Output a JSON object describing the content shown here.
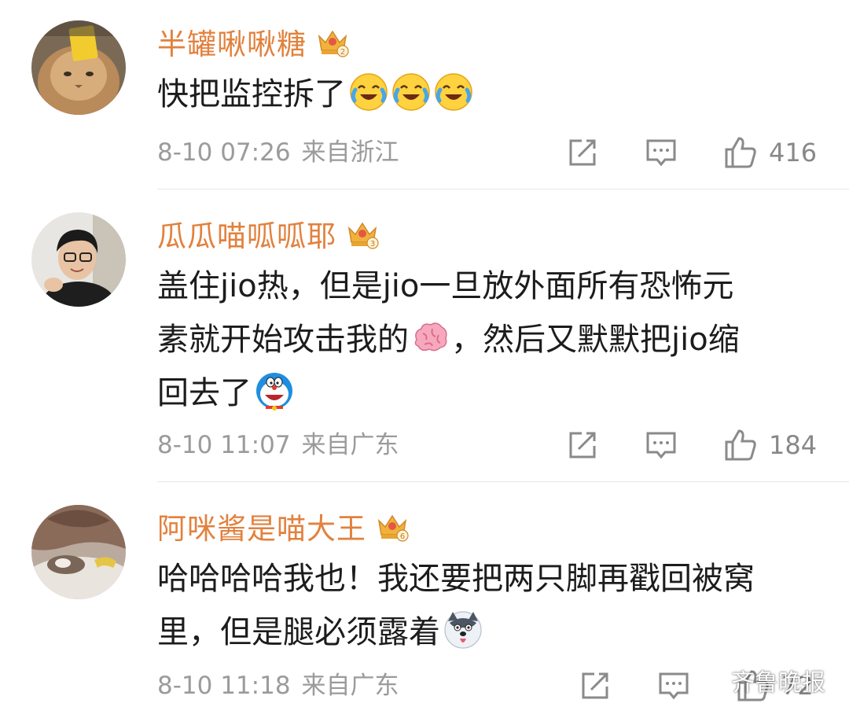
{
  "comments": [
    {
      "username": "半罐啾啾糖",
      "crown_level": "2",
      "text_lines": [
        "快把监控拆了"
      ],
      "emojis": [
        "laugh-cry-emoji",
        "laugh-cry-emoji",
        "laugh-cry-emoji"
      ],
      "date": "8-10 07:26",
      "origin": "来自浙江",
      "likes": "416"
    },
    {
      "username": "瓜瓜喵呱呱耶",
      "crown_level": "3",
      "text_lines": [
        "盖住jio热，但是jio一旦放外面所有恐怖元",
        "素就开始攻击我的",
        "，然后又默默把jio缩",
        "回去了"
      ],
      "emojis": [
        "brain-emoji",
        "doraemon-emoji"
      ],
      "date": "8-10 11:07",
      "origin": "来自广东",
      "likes": "184"
    },
    {
      "username": "阿咪酱是喵大王",
      "crown_level": "6",
      "text_lines": [
        "哈哈哈哈我也！我还要把两只脚再戳回被窝",
        "里，但是腿必须露着"
      ],
      "emojis": [
        "husky-emoji"
      ],
      "date": "8-10 11:18",
      "origin": "来自广东",
      "likes": "72"
    }
  ],
  "watermark": {
    "text": "齐鲁晚报",
    "icon": "wechat-icon"
  },
  "colors": {
    "username": "#e2813d",
    "body_text": "#1c1c1c",
    "meta_text": "#9b9b9b",
    "icon": "#8a8a8a",
    "divider": "#e6e6e6"
  }
}
